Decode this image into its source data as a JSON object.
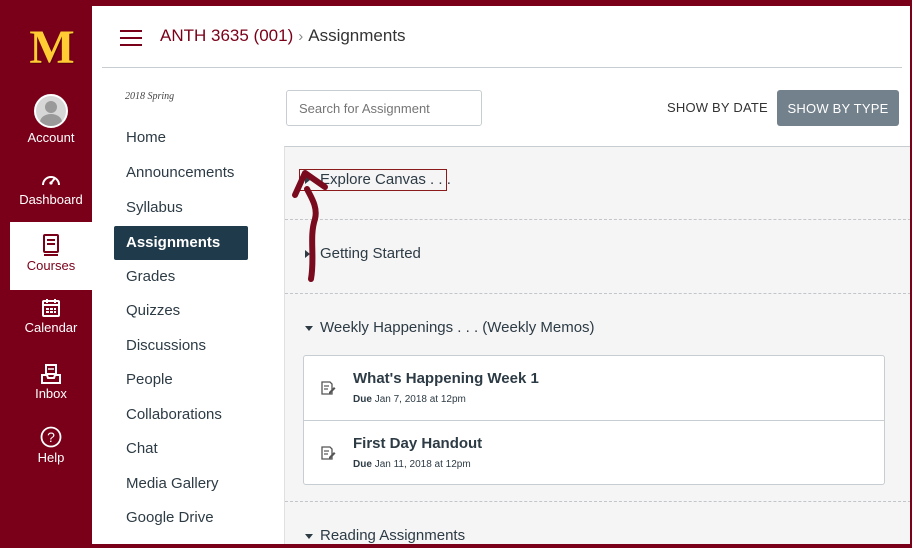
{
  "global_nav": {
    "logo": "M",
    "items": [
      {
        "label": "Account",
        "icon": "account-avatar"
      },
      {
        "label": "Dashboard",
        "icon": "dashboard-icon"
      },
      {
        "label": "Courses",
        "icon": "courses-icon",
        "active": true
      },
      {
        "label": "Calendar",
        "icon": "calendar-icon"
      },
      {
        "label": "Inbox",
        "icon": "inbox-icon"
      },
      {
        "label": "Help",
        "icon": "help-icon"
      }
    ]
  },
  "header": {
    "course": "ANTH 3635 (001)",
    "separator": "›",
    "page": "Assignments"
  },
  "course_nav": {
    "term": "2018 Spring",
    "items": [
      {
        "label": "Home"
      },
      {
        "label": "Announcements"
      },
      {
        "label": "Syllabus"
      },
      {
        "label": "Assignments",
        "active": true
      },
      {
        "label": "Grades"
      },
      {
        "label": "Quizzes"
      },
      {
        "label": "Discussions"
      },
      {
        "label": "People"
      },
      {
        "label": "Collaborations"
      },
      {
        "label": "Chat"
      },
      {
        "label": "Media Gallery"
      },
      {
        "label": "Google Drive"
      }
    ]
  },
  "toolbar": {
    "search_placeholder": "Search for Assignment",
    "show_by_date": "SHOW BY DATE",
    "show_by_type": "SHOW BY TYPE"
  },
  "groups": [
    {
      "title": "Explore Canvas . . .",
      "expanded": false
    },
    {
      "title": "Getting Started",
      "expanded": false
    },
    {
      "title": "Weekly Happenings . . . (Weekly Memos)",
      "expanded": true,
      "assignments": [
        {
          "title": "What's Happening Week 1",
          "due_label": "Due",
          "due": "Jan 7, 2018 at 12pm"
        },
        {
          "title": "First Day Handout",
          "due_label": "Due",
          "due": "Jan 11, 2018 at 12pm"
        }
      ]
    },
    {
      "title": "Reading Assignments",
      "expanded": true
    }
  ],
  "colors": {
    "brand_maroon": "#7a0019",
    "brand_gold": "#ffcc33",
    "active_nav": "#1f3a4a",
    "button_gray": "#73818c",
    "annotation_arrow": "#7a0a1e"
  }
}
